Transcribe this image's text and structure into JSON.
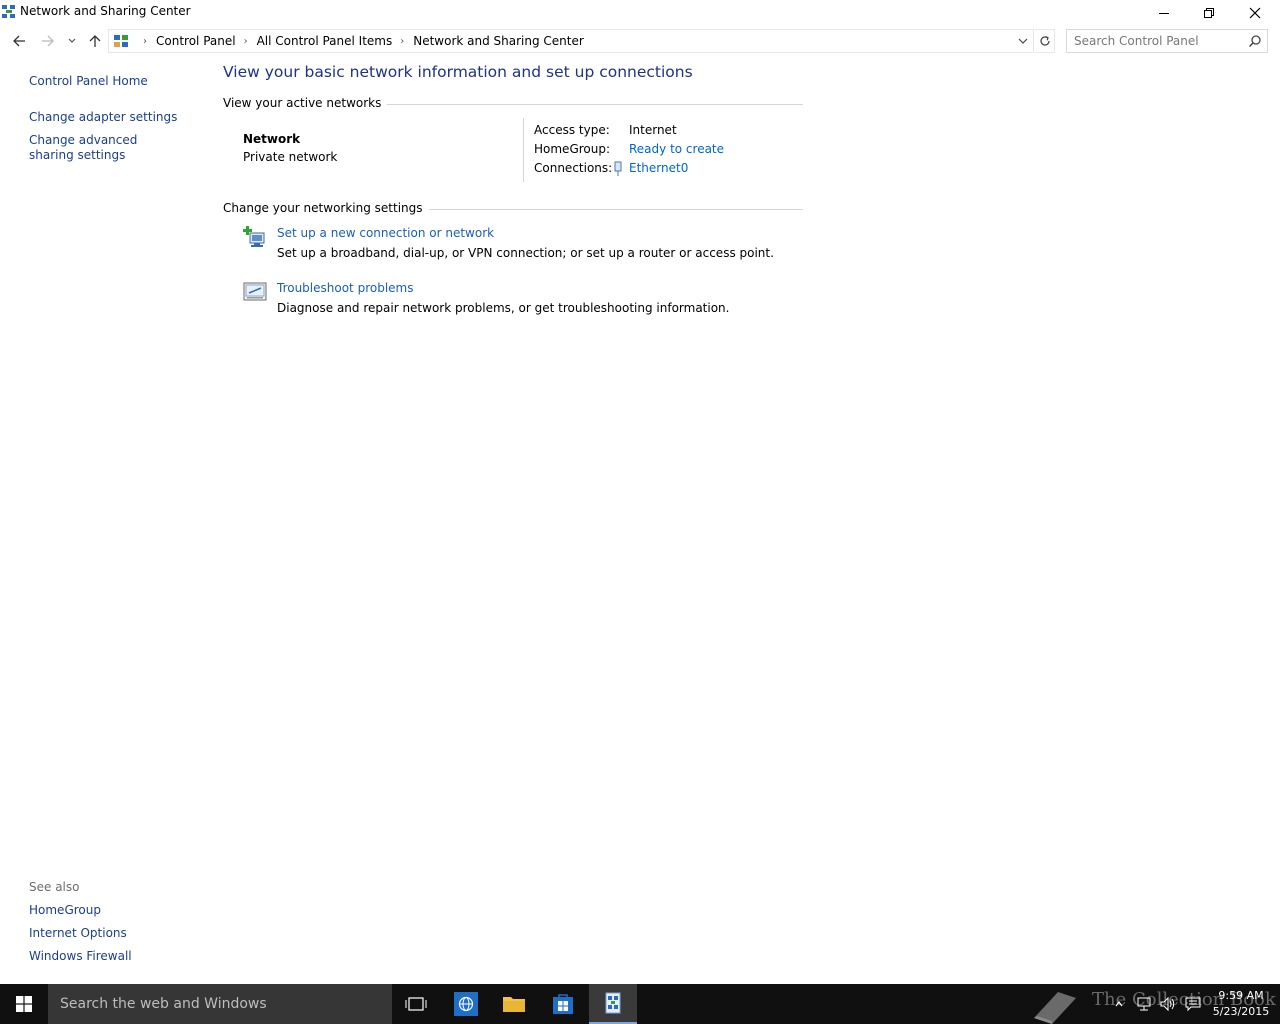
{
  "window": {
    "title": "Network and Sharing Center"
  },
  "address": {
    "crumbs": [
      "Control Panel",
      "All Control Panel Items",
      "Network and Sharing Center"
    ]
  },
  "search": {
    "placeholder": "Search Control Panel"
  },
  "sidebar": {
    "links": [
      "Control Panel Home",
      "Change adapter settings",
      "Change advanced sharing settings"
    ],
    "see_also_label": "See also",
    "see_also": [
      "HomeGroup",
      "Internet Options",
      "Windows Firewall"
    ]
  },
  "main": {
    "title": "View your basic network information and set up connections",
    "active_section": "View your active networks",
    "network": {
      "name": "Network",
      "type": "Private network",
      "access_label": "Access type:",
      "access_value": "Internet",
      "homegroup_label": "HomeGroup:",
      "homegroup_value": "Ready to create",
      "connections_label": "Connections:",
      "connections_value": "Ethernet0"
    },
    "settings_section": "Change your networking settings",
    "tasks": [
      {
        "link": "Set up a new connection or network",
        "desc": "Set up a broadband, dial-up, or VPN connection; or set up a router or access point."
      },
      {
        "link": "Troubleshoot problems",
        "desc": "Diagnose and repair network problems, or get troubleshooting information."
      }
    ]
  },
  "taskbar": {
    "search_placeholder": "Search the web and Windows",
    "watermark": "The Collection Book",
    "time": "9:59 AM",
    "date": "5/23/2015"
  }
}
